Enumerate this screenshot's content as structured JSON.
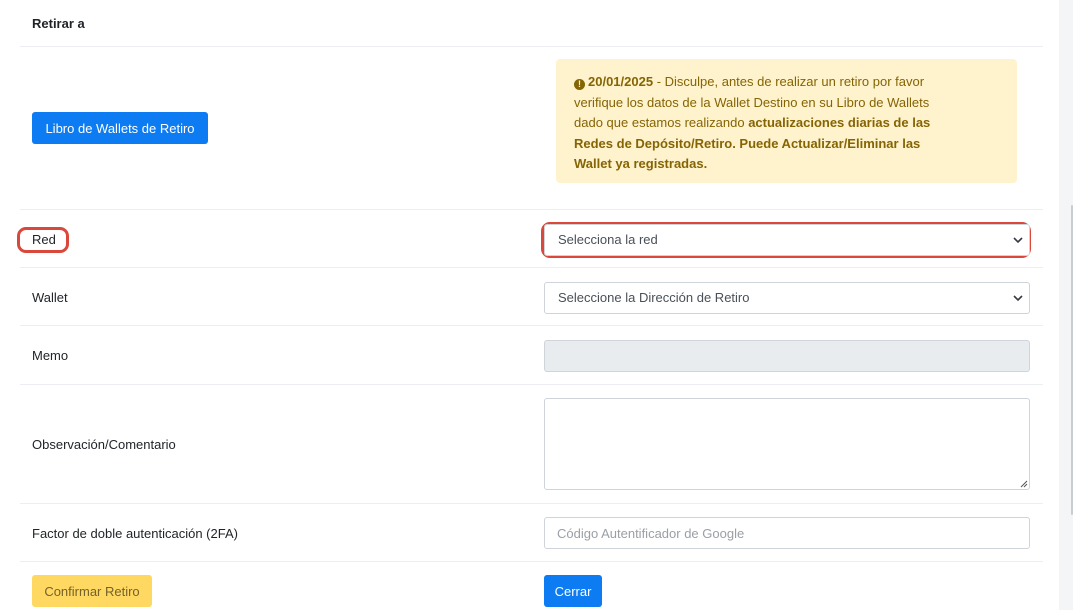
{
  "section": {
    "title": "Retirar a"
  },
  "wallets_book_button": "Libro de Wallets de Retiro",
  "notice": {
    "date": "20/01/2025",
    "text_intro": " - Disculpe, antes de realizar un retiro por favor verifique los datos de la Wallet Destino en su Libro de Wallets dado que estamos realizando ",
    "text_bold": "actualizaciones diarias de las Redes de Depósito/Retiro. Puede Actualizar/Eliminar las Wallet ya registradas.",
    "icon": "exclamation-circle-icon"
  },
  "form": {
    "network": {
      "label": "Red",
      "value": "Selecciona la red"
    },
    "wallet": {
      "label": "Wallet",
      "value": "Seleccione la Dirección de Retiro"
    },
    "memo": {
      "label": "Memo",
      "value": ""
    },
    "comment": {
      "label": "Observación/Comentario",
      "value": ""
    },
    "twofa": {
      "label": "Factor de doble autenticación (2FA)",
      "placeholder": "Código Autentificador de Google"
    }
  },
  "actions": {
    "confirm": "Confirmar Retiro",
    "close": "Cerrar"
  },
  "colors": {
    "primary": "#0d7cf2",
    "warning": "#ffd65a",
    "alert_bg": "#fff3cd",
    "alert_text": "#856404",
    "highlight": "#d9483a"
  }
}
